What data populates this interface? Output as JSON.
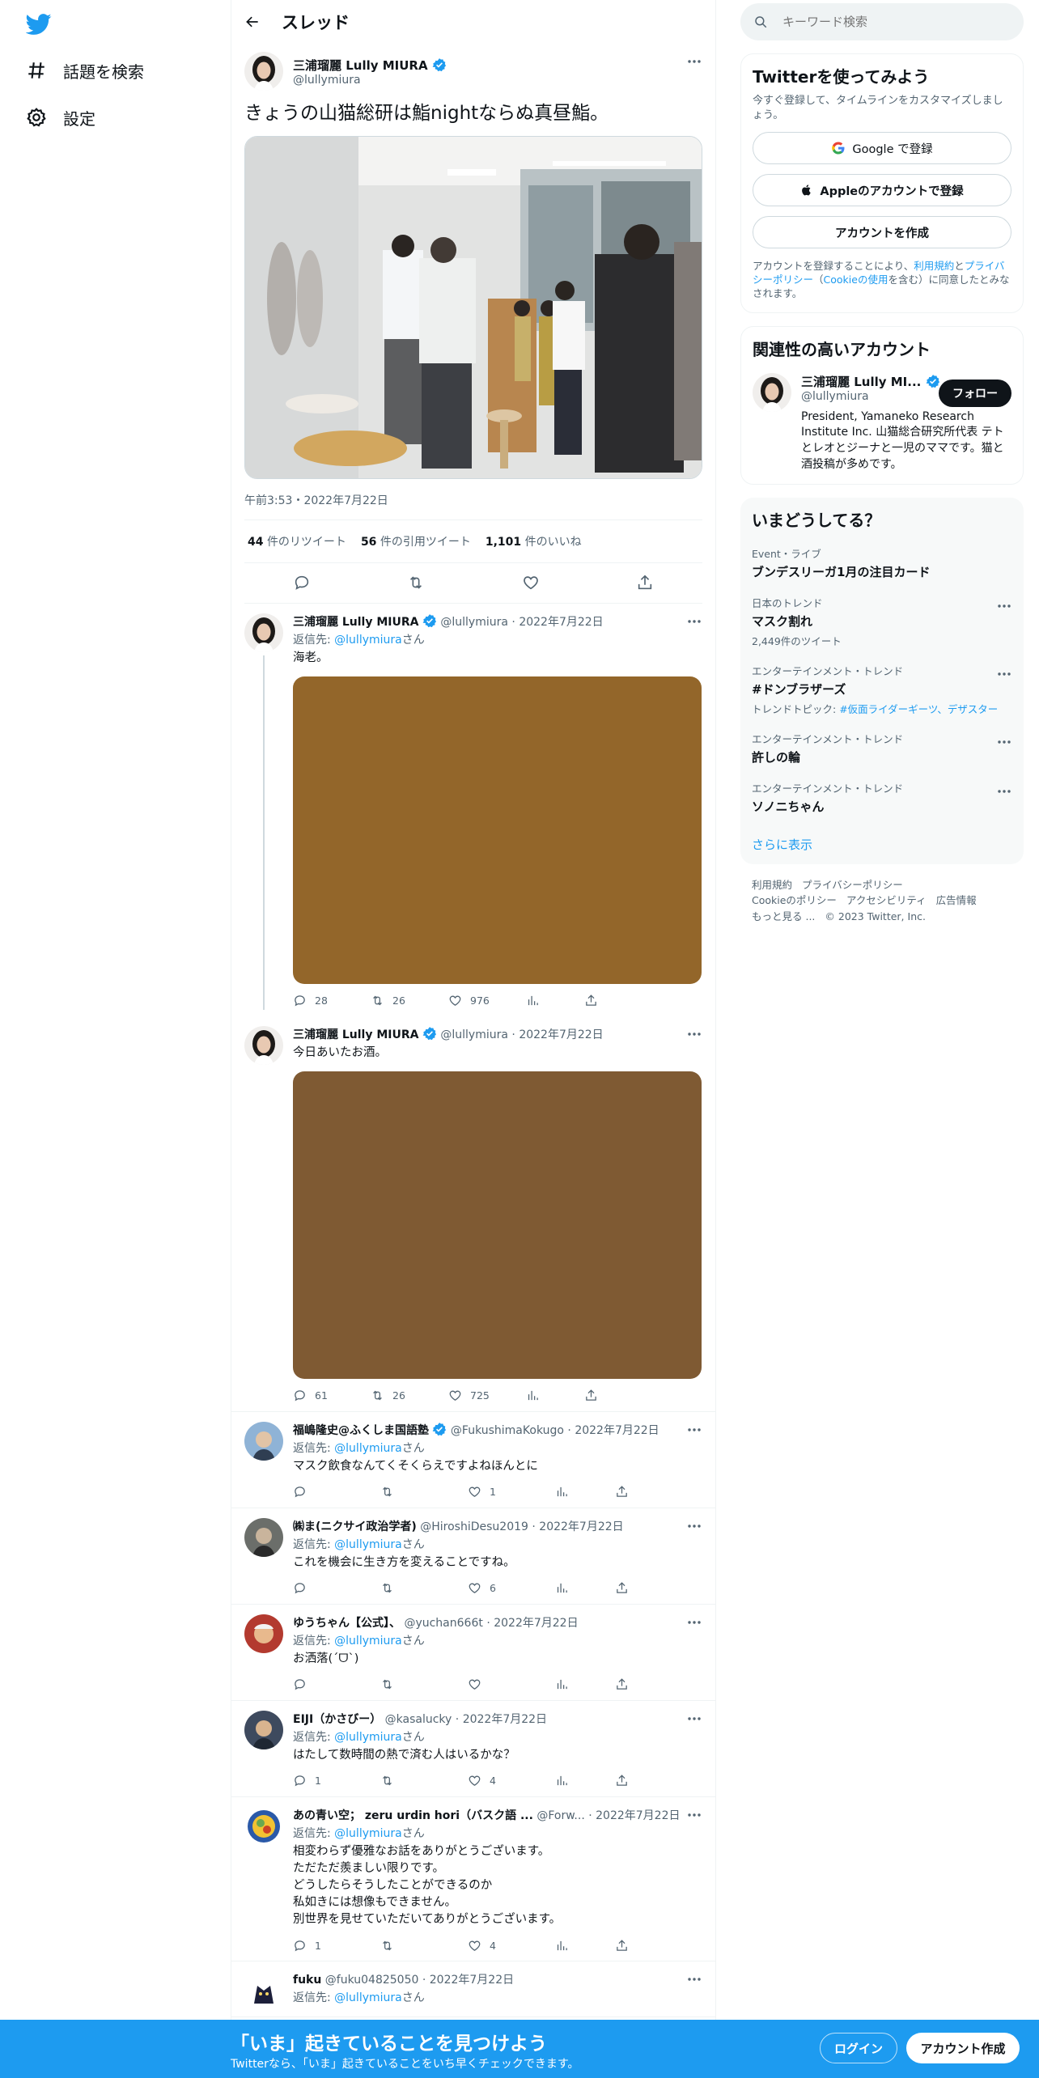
{
  "nav": {
    "explore": "話題を検索",
    "settings": "設定"
  },
  "thread": {
    "title": "スレッド"
  },
  "main_tweet": {
    "name": "三浦瑠麗 Lully MIURA",
    "handle": "@lullymiura",
    "text": "きょうの山猫総研は鮨nightならぬ真昼鮨。",
    "time": "午前3:53・2022年7月22日",
    "retweets": "44",
    "retweets_label": "件のリツイート",
    "quotes": "56",
    "quotes_label": "件の引用ツイート",
    "likes": "1,101",
    "likes_label": "件のいいね"
  },
  "replies": [
    {
      "name": "三浦瑠麗 Lully MIURA",
      "handle": "@lullymiura",
      "date": "2022年7月22日",
      "reply_prefix": "返信先: ",
      "reply_to": "@lullymiura",
      "reply_suffix": "さん",
      "text": "海老。",
      "photo_color": "#93662a",
      "replies": "28",
      "retweets": "26",
      "likes": "976"
    },
    {
      "name": "三浦瑠麗 Lully MIURA",
      "handle": "@lullymiura",
      "date": "2022年7月22日",
      "text": "今日あいたお酒。",
      "photo_color": "#7f5a33",
      "replies": "61",
      "retweets": "26",
      "likes": "725"
    },
    {
      "name": "福嶋隆史@ふくしま国語塾",
      "handle": "@FukushimaKokugo",
      "date": "2022年7月22日",
      "reply_prefix": "返信先: ",
      "reply_to": "@lullymiura",
      "reply_suffix": "さん",
      "text": "マスク飲食なんてくそくらえですよねほんとに",
      "replies": "",
      "retweets": "",
      "likes": "1"
    },
    {
      "name": "㈱ま(ニクサイ政治学者)",
      "handle": "@HiroshiDesu2019",
      "date": "2022年7月22日",
      "reply_prefix": "返信先: ",
      "reply_to": "@lullymiura",
      "reply_suffix": "さん",
      "text": "これを機会に生き方を変えることですね。",
      "replies": "",
      "retweets": "",
      "likes": "6"
    },
    {
      "name": "ゆうちゃん【公式】、",
      "handle": "@yuchan666t",
      "date": "2022年7月22日",
      "reply_prefix": "返信先: ",
      "reply_to": "@lullymiura",
      "reply_suffix": "さん",
      "text": "お洒落(ˊᗜˋ)",
      "replies": "",
      "retweets": "",
      "likes": ""
    },
    {
      "name": "EIJI（かさびー）",
      "handle": "@kasalucky",
      "date": "2022年7月22日",
      "reply_prefix": "返信先: ",
      "reply_to": "@lullymiura",
      "reply_suffix": "さん",
      "text": "はたして数時間の熱で済む人はいるかな？",
      "replies": "1",
      "retweets": "",
      "likes": "4"
    },
    {
      "name": "あの青い空； zeru urdin hori（バスク語 ...",
      "handle": "@Forw...",
      "date": "2022年7月22日",
      "reply_prefix": "返信先: ",
      "reply_to": "@lullymiura",
      "reply_suffix": "さん",
      "text": "相変わらず優雅なお話をありがとうございます。\nただただ羨ましい限りです。\nどうしたらそうしたことができるのか\n私如きには想像もできません。\n別世界を見せていただいてありがとうございます。",
      "replies": "1",
      "retweets": "",
      "likes": "4"
    },
    {
      "name": "fuku",
      "handle": "@fuku04825050",
      "date": "2022年7月22日",
      "reply_prefix": "返信先: ",
      "reply_to": "@lullymiura",
      "reply_suffix": "さん",
      "text": "",
      "replies": "",
      "retweets": "",
      "likes": ""
    }
  ],
  "search": {
    "placeholder": "キーワード検索"
  },
  "signup": {
    "title": "Twitterを使ってみよう",
    "sub": "今すぐ登録して、タイムラインをカスタマイズしましょう。",
    "google": "Google で登録",
    "apple": "Appleのアカウントで登録",
    "create": "アカウントを作成",
    "legal_pre": "アカウントを登録することにより、",
    "terms": "利用規約",
    "and": "と",
    "privacy": "プライバシーポリシー",
    "paren_open": "（",
    "cookie": "Cookieの使用",
    "legal_post": "を含む）に同意したとみなされます。"
  },
  "related": {
    "title": "関連性の高いアカウント",
    "name": "三浦瑠麗 Lully MI...",
    "handle": "@lullymiura",
    "follow": "フォロー",
    "bio": "President, Yamaneko Research Institute Inc. 山猫総合研究所代表 テトとレオとジーナと一児のママです。猫と酒投稿が多めです。"
  },
  "trends": {
    "title": "いまどうしてる？",
    "items": [
      {
        "category": "Event・ライブ",
        "name": "ブンデスリーガ1月の注目カード",
        "meta": ""
      },
      {
        "category": "日本のトレンド",
        "name": "マスク割れ",
        "meta": "2,449件のツイート"
      },
      {
        "category": "エンターテインメント・トレンド",
        "name": "#ドンブラザーズ",
        "meta_prefix": "トレンドトピック: ",
        "meta_link": "#仮面ライダーギーツ、デザスター"
      },
      {
        "category": "エンターテインメント・トレンド",
        "name": "許しの輪",
        "meta": ""
      },
      {
        "category": "エンターテインメント・トレンド",
        "name": "ソノニちゃん",
        "meta": ""
      }
    ],
    "show_more": "さらに表示"
  },
  "footer": {
    "terms": "利用規約",
    "privacy": "プライバシーポリシー",
    "cookie": "Cookieのポリシー",
    "accessibility": "アクセシビリティ",
    "ads": "広告情報",
    "more": "もっと見る ...",
    "copyright": "© 2023 Twitter, Inc."
  },
  "bottom_bar": {
    "title": "「いま」起きていることを見つけよう",
    "sub": "Twitterなら、「いま」起きていることをいち早くチェックできます。",
    "login": "ログイン",
    "signup": "アカウント作成"
  },
  "colors": {
    "brand": "#1d9bf0",
    "text": "#0f1419",
    "muted": "#536471"
  }
}
